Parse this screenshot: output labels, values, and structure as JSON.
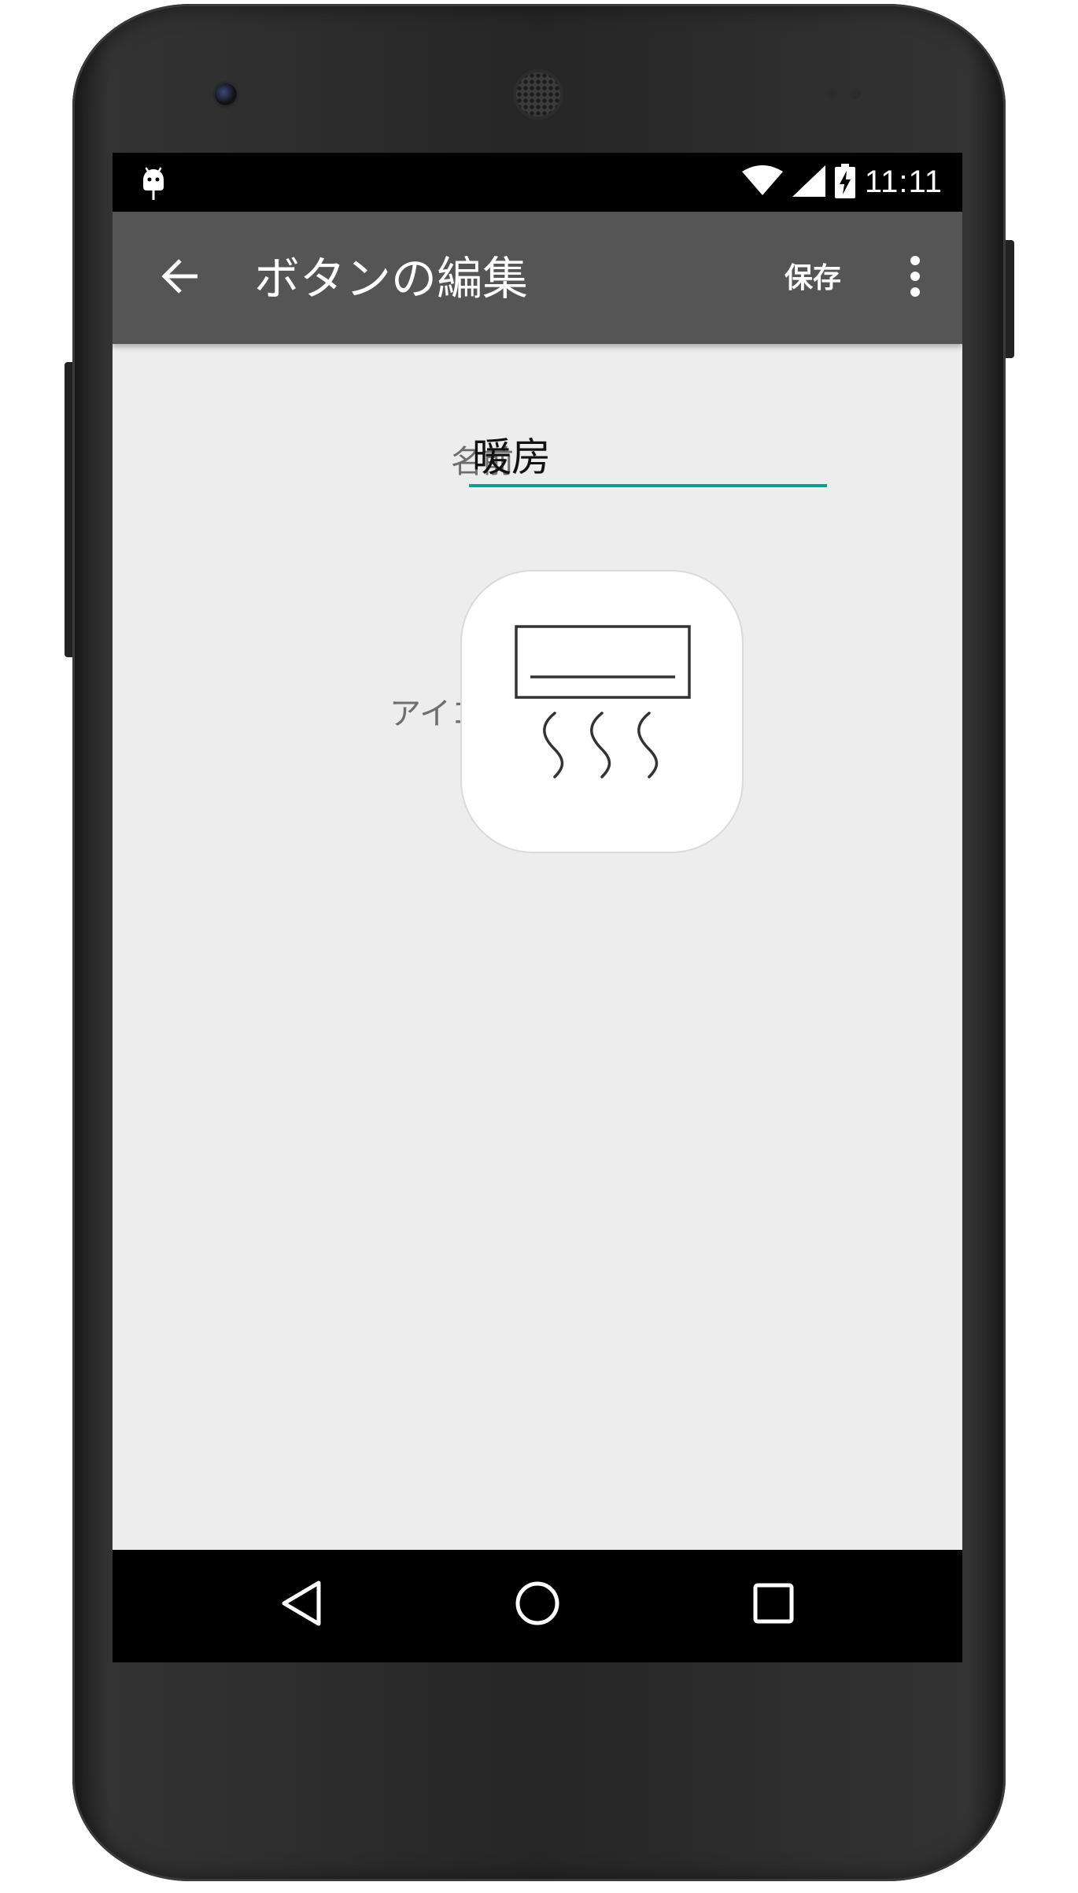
{
  "status_bar": {
    "time": "11:11",
    "notification_icon": "android-debug-icon",
    "wifi_icon": "wifi-icon",
    "signal_icon": "cell-signal-icon",
    "battery_icon": "battery-charging-icon"
  },
  "app_bar": {
    "back_icon": "arrow-back-icon",
    "title": "ボタンの編集",
    "save_label": "保存",
    "more_icon": "more-vert-icon",
    "background": "#555555"
  },
  "form": {
    "name_label": "名前",
    "name_value": "暖房",
    "icon_label": "アイコン",
    "selected_icon": "air-conditioner-heating-icon",
    "accent_color": "#1a9a8a"
  },
  "nav_bar": {
    "back_icon": "nav-back-icon",
    "home_icon": "nav-home-icon",
    "recents_icon": "nav-recents-icon"
  }
}
